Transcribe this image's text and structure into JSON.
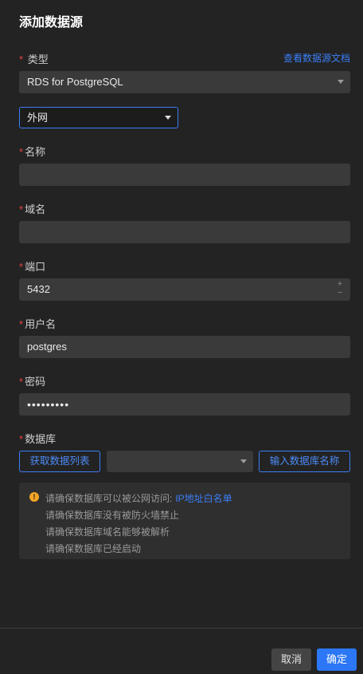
{
  "dialog": {
    "title": "添加数据源"
  },
  "type_field": {
    "label": "类型",
    "doc_link": "查看数据源文档",
    "value": "RDS for PostgreSQL"
  },
  "network": {
    "value": "外网"
  },
  "name_field": {
    "label": "名称",
    "value": ""
  },
  "domain_field": {
    "label": "域名",
    "value": ""
  },
  "port_field": {
    "label": "端口",
    "value": "5432",
    "plus": "+",
    "minus": "−"
  },
  "username_field": {
    "label": "用户名",
    "value": "postgres"
  },
  "password_field": {
    "label": "密码",
    "value": "•••••••••"
  },
  "database_field": {
    "label": "数据库",
    "fetch_button": "获取数据列表",
    "select_value": "",
    "input_button": "输入数据库名称"
  },
  "notice": {
    "lines": [
      "请确保数据库可以被公网访问:",
      "请确保数据库没有被防火墙禁止",
      "请确保数据库域名能够被解析",
      "请确保数据库已经启动"
    ],
    "link": "IP地址白名单"
  },
  "footer": {
    "cancel": "取消",
    "confirm": "确定"
  },
  "colors": {
    "accent": "#2b77f5",
    "required": "#e64545",
    "warning": "#f5a524",
    "background": "#232323"
  }
}
